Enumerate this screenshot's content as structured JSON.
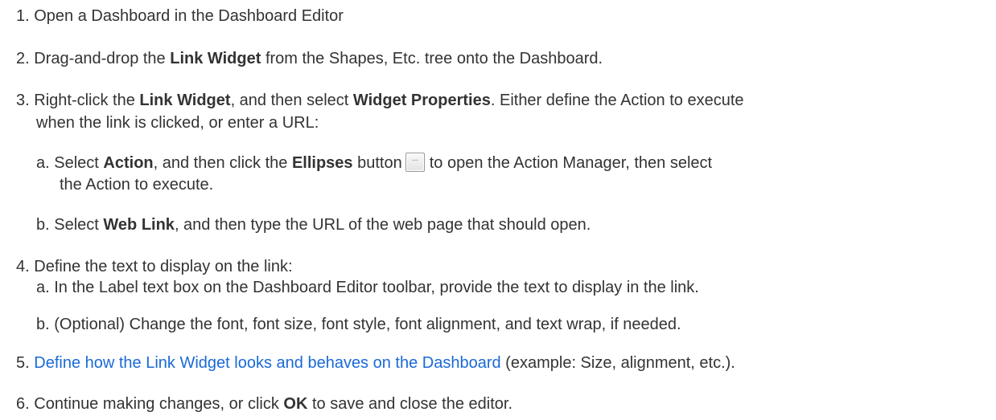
{
  "steps": {
    "s1": {
      "num": "1.",
      "text": "Open a Dashboard in the Dashboard Editor"
    },
    "s2": {
      "num": "2.",
      "pre": "Drag-and-drop the ",
      "bold": "Link Widget",
      "post": " from the Shapes, Etc. tree onto the Dashboard."
    },
    "s3": {
      "num": "3.",
      "pre": "Right-click the ",
      "bold1": "Link Widget",
      "mid": ", and then select ",
      "bold2": "Widget Properties",
      "post": ". Either define the Action to execute",
      "line2": "when the link is clicked, or enter a URL:",
      "a": {
        "num": "a.",
        "pre": "Select ",
        "bold1": "Action",
        "mid": ", and then click the ",
        "bold2": "Ellipses",
        "post1": " button",
        "post2": "to open the Action Manager, then select",
        "line2": "the Action to execute."
      },
      "b": {
        "num": "b.",
        "pre": "Select ",
        "bold": "Web Link",
        "post": ", and then type the URL of the web page that should open."
      }
    },
    "s4": {
      "num": "4.",
      "text": "Define the text to display on the link:",
      "a": {
        "num": "a.",
        "text": "In the Label text box on the Dashboard Editor toolbar, provide the text to display in the link."
      },
      "b": {
        "num": "b.",
        "text": "(Optional) Change the font, font size, font style, font alignment, and text wrap, if needed."
      }
    },
    "s5": {
      "num": "5.",
      "link": "Define how the Link Widget looks and behaves on the Dashboard",
      "post": " (example: Size, alignment, etc.)."
    },
    "s6": {
      "num": "6.",
      "pre": "Continue making changes, or click ",
      "bold": "OK",
      "post": " to save and close the editor."
    }
  },
  "icons": {
    "ellipses": "ellipsis-button-icon",
    "ellipses_glyph": "..."
  },
  "colors": {
    "text": "#333333",
    "link": "#1a6ad6"
  }
}
